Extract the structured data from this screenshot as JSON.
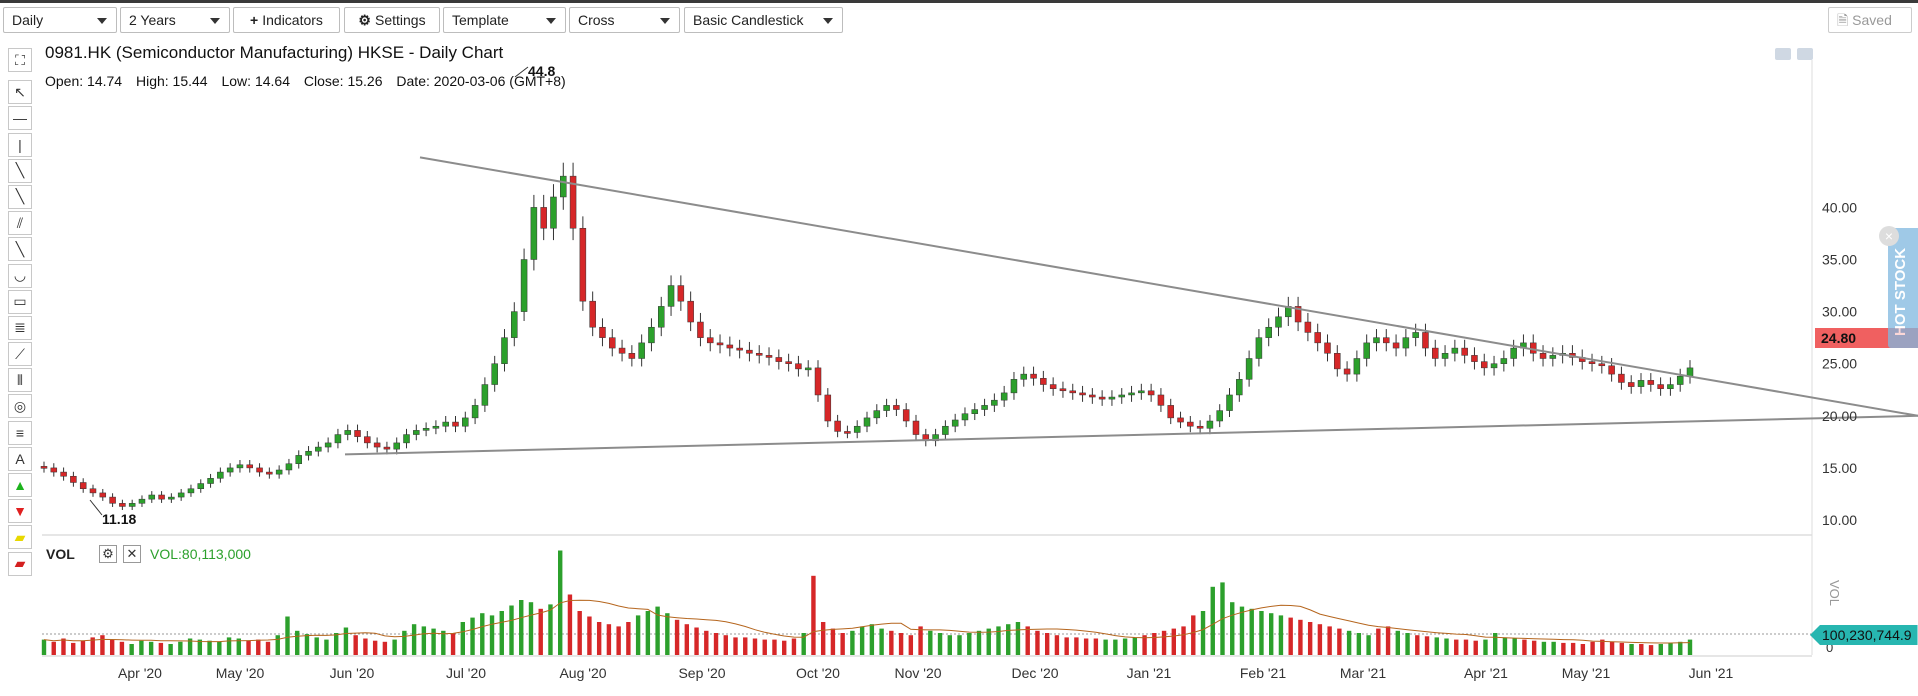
{
  "toolbar": {
    "interval": "Daily",
    "range": "2 Years",
    "indicators": "Indicators",
    "settings": "Settings",
    "template": "Template",
    "crosshair": "Cross",
    "chart_style": "Basic Candlestick",
    "saved": "Saved",
    "plus_icon": "+",
    "gear_icon": "⚙"
  },
  "left_tools": [
    "cursor-icon",
    "horizontal-line-icon",
    "vertical-line-icon",
    "trend-line-icon",
    "ray-icon",
    "parallel-channel-icon",
    "extended-line-icon",
    "arc-icon",
    "rectangle-icon",
    "fib-retracement-icon",
    "fan-icon",
    "time-zones-icon",
    "ellipse-icon",
    "gann-icon",
    "text-icon",
    "buy-arrow-icon",
    "sell-arrow-icon",
    "highlighter-icon",
    "eraser-icon"
  ],
  "chart": {
    "title": "0981.HK (Semiconductor Manufacturing) HKSE - Daily Chart",
    "open_label": "Open:",
    "open": "14.74",
    "high_label": "High:",
    "high": "15.44",
    "low_label": "Low:",
    "low": "14.64",
    "close_label": "Close:",
    "close": "15.26",
    "date_label": "Date:",
    "date": "2020-03-06",
    "tz": "(GMT+8)",
    "high_annotation": "44.8",
    "low_annotation": "11.18",
    "price_tag": "24.80",
    "hot_stock": "HOT STOCK",
    "hot_close": "×"
  },
  "volume": {
    "label": "VOL",
    "value_text": "VOL:80,113,000",
    "tag": "100,230,744.9",
    "axis_label": "VOL",
    "zero": "0",
    "settings_icon": "⚙",
    "close_icon": "✕"
  },
  "colors": {
    "up": "#2ca02c",
    "down": "#d62728",
    "line": "#8c8c8c",
    "ma": "#b5651d"
  },
  "chart_data": {
    "type": "candlestick",
    "y_ticks": [
      "40.00",
      "35.00",
      "30.00",
      "25.00",
      "20.00",
      "15.00",
      "10.00"
    ],
    "ylim": [
      10,
      44
    ],
    "x_labels": [
      "Apr '20",
      "May '20",
      "Jun '20",
      "Jul '20",
      "Aug '20",
      "Sep '20",
      "Oct '20",
      "Nov '20",
      "Dec '20",
      "Jan '21",
      "Feb '21",
      "Mar '21",
      "Apr '21",
      "May '21",
      "Jun '21"
    ],
    "closes": [
      15.0,
      14.6,
      14.2,
      13.6,
      13.0,
      12.6,
      12.2,
      11.6,
      11.3,
      11.6,
      12.0,
      12.4,
      12.0,
      12.2,
      12.6,
      13.0,
      13.5,
      14.0,
      14.6,
      15.0,
      15.3,
      15.0,
      14.6,
      14.4,
      14.8,
      15.4,
      16.2,
      16.6,
      17.0,
      17.4,
      18.2,
      18.6,
      18.0,
      17.4,
      17.0,
      16.8,
      17.4,
      18.2,
      18.6,
      18.8,
      19.0,
      19.4,
      19.0,
      19.8,
      21.0,
      23.0,
      25.0,
      27.5,
      30.0,
      35.0,
      40.0,
      38.0,
      41.0,
      43.0,
      38.0,
      31.0,
      28.5,
      27.5,
      26.5,
      26.0,
      25.5,
      27.0,
      28.5,
      30.5,
      32.5,
      31.0,
      29.0,
      27.5,
      27.0,
      26.8,
      26.5,
      26.3,
      26.0,
      25.8,
      25.6,
      25.2,
      25.0,
      24.5,
      24.6,
      22.0,
      19.5,
      18.5,
      18.4,
      19.0,
      19.8,
      20.5,
      21.0,
      20.6,
      19.5,
      18.2,
      17.6,
      18.2,
      19.0,
      19.6,
      20.2,
      20.6,
      21.0,
      21.5,
      22.2,
      23.5,
      24.0,
      23.6,
      23.0,
      22.6,
      22.4,
      22.2,
      22.0,
      21.8,
      21.6,
      21.8,
      22.0,
      22.2,
      22.4,
      22.0,
      21.0,
      19.8,
      19.4,
      19.0,
      18.8,
      19.5,
      20.5,
      22.0,
      23.5,
      25.5,
      27.5,
      28.5,
      29.5,
      30.5,
      29.0,
      28.0,
      27.0,
      26.0,
      24.5,
      24.0,
      25.5,
      27.0,
      27.5,
      27.0,
      26.5,
      27.5,
      28.0,
      26.5,
      25.5,
      26.0,
      26.5,
      25.8,
      25.2,
      24.6,
      25.0,
      25.5,
      26.5,
      27.0,
      26.0,
      25.5,
      25.8,
      26.0,
      25.6,
      25.2,
      25.0,
      24.8,
      24.0,
      23.2,
      22.8,
      23.4,
      23.0,
      22.6,
      23.0,
      23.8,
      24.6
    ],
    "volumes": [
      14,
      12,
      15,
      11,
      13,
      16,
      18,
      14,
      12,
      10,
      13,
      12,
      11,
      10,
      12,
      15,
      14,
      13,
      12,
      16,
      15,
      13,
      14,
      12,
      18,
      35,
      22,
      19,
      16,
      14,
      20,
      25,
      18,
      15,
      13,
      12,
      14,
      22,
      28,
      26,
      24,
      22,
      20,
      30,
      34,
      38,
      36,
      40,
      45,
      50,
      48,
      42,
      46,
      95,
      55,
      40,
      35,
      30,
      28,
      26,
      30,
      36,
      40,
      44,
      38,
      32,
      28,
      25,
      22,
      20,
      18,
      16,
      16,
      15,
      14,
      14,
      13,
      15,
      20,
      72,
      30,
      24,
      20,
      22,
      26,
      28,
      24,
      22,
      20,
      18,
      26,
      22,
      20,
      18,
      18,
      20,
      22,
      24,
      26,
      28,
      30,
      26,
      22,
      20,
      18,
      16,
      16,
      15,
      15,
      14,
      14,
      15,
      16,
      18,
      20,
      22,
      24,
      26,
      36,
      40,
      62,
      66,
      48,
      44,
      42,
      40,
      38,
      36,
      34,
      32,
      30,
      28,
      26,
      24,
      22,
      20,
      18,
      24,
      26,
      22,
      20,
      18,
      17,
      16,
      15,
      14,
      14,
      13,
      14,
      20,
      16,
      15,
      14,
      13,
      12,
      12,
      11,
      11,
      10,
      12,
      14,
      12,
      11,
      10,
      10,
      9,
      10,
      11,
      12,
      14
    ],
    "trendlines": [
      {
        "from": [
          420,
          44.8
        ],
        "to": [
          1918,
          20.0
        ]
      },
      {
        "from": [
          345,
          16.3
        ],
        "to": [
          1918,
          20.0
        ]
      }
    ]
  }
}
